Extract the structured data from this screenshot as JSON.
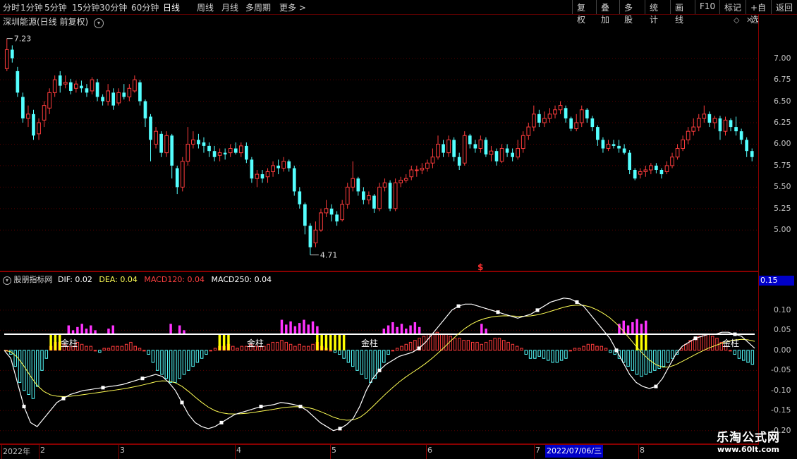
{
  "toolbar": {
    "left": [
      "分时",
      "1分钟",
      "5分钟",
      "15分钟",
      "30分钟",
      "60分钟",
      "日线",
      "周线",
      "月线",
      "多周期",
      "更多 >"
    ],
    "active": "日线",
    "right": [
      "复权",
      "叠加",
      "多股",
      "统计",
      "画线",
      "F10",
      "标记",
      "+自选",
      "返回"
    ]
  },
  "main": {
    "title": "深圳能源(日线 前复权)",
    "high_label": "7.23",
    "low_label": "4.71",
    "signal_label": "$",
    "y_labels": [
      "7.00",
      "6.75",
      "6.50",
      "6.25",
      "6.00",
      "5.75",
      "5.50",
      "5.25",
      "5.00"
    ]
  },
  "indicator": {
    "name": "股朋指标网",
    "dif": "DIF: 0.02",
    "dea": "DEA: 0.04",
    "macd120": "MACD120: 0.04",
    "macd250": "MACD250: 0.04",
    "current_value": "0.15",
    "y_labels": [
      "0.10",
      "0.05",
      "0.00",
      "-0.05",
      "-0.10",
      "-0.15",
      "-0.20"
    ],
    "golden_label": "金柱"
  },
  "date_axis": {
    "labels": [
      "2022年",
      "2",
      "3",
      "4",
      "5",
      "6",
      "7",
      "8"
    ],
    "cursor_date": "2022/07/06/三"
  },
  "watermark": {
    "title": "乐淘公式网",
    "url": "www.60lt.com"
  },
  "colors": {
    "up": "#ff3c3c",
    "down": "#54ffff",
    "grid": "#5a0000",
    "dif": "#ffffff",
    "dea": "#ffff55",
    "magenta": "#ff33ff",
    "yellow": "#ffff00"
  },
  "chart_data": {
    "type": "candlestick",
    "candles": [
      [
        6.88,
        7.1,
        7.23,
        6.85
      ],
      [
        7.1,
        7.0,
        7.15,
        6.95
      ],
      [
        6.85,
        6.6,
        6.9,
        6.55
      ],
      [
        6.55,
        6.3,
        6.6,
        6.25
      ],
      [
        6.3,
        6.35,
        6.45,
        6.2
      ],
      [
        6.35,
        6.1,
        6.4,
        6.05
      ],
      [
        6.12,
        6.25,
        6.3,
        6.05
      ],
      [
        6.28,
        6.45,
        6.5,
        6.2
      ],
      [
        6.42,
        6.6,
        6.65,
        6.35
      ],
      [
        6.6,
        6.75,
        6.8,
        6.55
      ],
      [
        6.8,
        6.68,
        6.85,
        6.6
      ],
      [
        6.7,
        6.72,
        6.8,
        6.65
      ],
      [
        6.72,
        6.62,
        6.76,
        6.58
      ],
      [
        6.65,
        6.7,
        6.74,
        6.6
      ],
      [
        6.68,
        6.65,
        6.74,
        6.6
      ],
      [
        6.65,
        6.6,
        6.7,
        6.55
      ],
      [
        6.62,
        6.75,
        6.78,
        6.58
      ],
      [
        6.72,
        6.55,
        6.76,
        6.5
      ],
      [
        6.55,
        6.5,
        6.58,
        6.45
      ],
      [
        6.5,
        6.62,
        6.7,
        6.45
      ],
      [
        6.6,
        6.45,
        6.65,
        6.4
      ],
      [
        6.48,
        6.6,
        6.65,
        6.45
      ],
      [
        6.6,
        6.55,
        6.7,
        6.52
      ],
      [
        6.55,
        6.65,
        6.7,
        6.5
      ],
      [
        6.62,
        6.75,
        6.8,
        6.6
      ],
      [
        6.72,
        6.5,
        6.75,
        6.45
      ],
      [
        6.5,
        6.3,
        6.52,
        6.2
      ],
      [
        6.32,
        6.05,
        6.35,
        5.8
      ],
      [
        6.0,
        6.15,
        6.2,
        5.95
      ],
      [
        6.12,
        5.9,
        6.15,
        5.85
      ],
      [
        5.9,
        6.1,
        6.15,
        5.85
      ],
      [
        6.1,
        5.75,
        6.12,
        5.6
      ],
      [
        5.72,
        5.5,
        5.75,
        5.42
      ],
      [
        5.5,
        5.8,
        5.85,
        5.45
      ],
      [
        5.8,
        6.0,
        6.2,
        5.75
      ],
      [
        6.0,
        6.05,
        6.15,
        5.95
      ],
      [
        6.05,
        6.0,
        6.12,
        5.95
      ],
      [
        6.02,
        5.98,
        6.08,
        5.9
      ],
      [
        5.98,
        5.92,
        6.02,
        5.85
      ],
      [
        5.92,
        5.85,
        5.98,
        5.8
      ],
      [
        5.87,
        5.9,
        5.95,
        5.8
      ],
      [
        5.9,
        5.88,
        5.95,
        5.82
      ],
      [
        5.9,
        5.95,
        6.0,
        5.85
      ],
      [
        5.95,
        5.9,
        6.02,
        5.88
      ],
      [
        5.9,
        5.98,
        6.02,
        5.85
      ],
      [
        5.98,
        5.82,
        6.02,
        5.78
      ],
      [
        5.82,
        5.6,
        5.85,
        5.55
      ],
      [
        5.6,
        5.65,
        5.7,
        5.5
      ],
      [
        5.65,
        5.6,
        5.7,
        5.55
      ],
      [
        5.62,
        5.68,
        5.72,
        5.55
      ],
      [
        5.68,
        5.75,
        5.8,
        5.62
      ],
      [
        5.75,
        5.72,
        5.82,
        5.65
      ],
      [
        5.72,
        5.8,
        5.85,
        5.68
      ],
      [
        5.8,
        5.72,
        5.82,
        5.68
      ],
      [
        5.72,
        5.45,
        5.75,
        5.4
      ],
      [
        5.45,
        5.3,
        5.5,
        5.25
      ],
      [
        5.3,
        5.05,
        5.32,
        4.95
      ],
      [
        5.05,
        4.8,
        5.08,
        4.71
      ],
      [
        4.85,
        5.0,
        5.1,
        4.8
      ],
      [
        5.0,
        5.2,
        5.25,
        4.98
      ],
      [
        5.2,
        5.25,
        5.35,
        5.15
      ],
      [
        5.25,
        5.18,
        5.3,
        5.1
      ],
      [
        5.18,
        5.1,
        5.22,
        5.05
      ],
      [
        5.12,
        5.3,
        5.35,
        5.1
      ],
      [
        5.3,
        5.5,
        5.55,
        5.25
      ],
      [
        5.5,
        5.6,
        5.8,
        5.45
      ],
      [
        5.6,
        5.45,
        5.62,
        5.4
      ],
      [
        5.45,
        5.35,
        5.5,
        5.3
      ],
      [
        5.35,
        5.4,
        5.45,
        5.3
      ],
      [
        5.4,
        5.25,
        5.42,
        5.2
      ],
      [
        5.25,
        5.5,
        5.55,
        5.22
      ],
      [
        5.5,
        5.55,
        5.6,
        5.45
      ],
      [
        5.55,
        5.25,
        5.58,
        5.22
      ],
      [
        5.25,
        5.55,
        5.6,
        5.22
      ],
      [
        5.55,
        5.58,
        5.62,
        5.5
      ],
      [
        5.58,
        5.6,
        5.65,
        5.55
      ],
      [
        5.62,
        5.7,
        5.75,
        5.58
      ],
      [
        5.7,
        5.7,
        5.75,
        5.62
      ],
      [
        5.7,
        5.72,
        5.78,
        5.65
      ],
      [
        5.72,
        5.78,
        5.82,
        5.68
      ],
      [
        5.78,
        5.85,
        5.95,
        5.72
      ],
      [
        5.85,
        6.0,
        6.1,
        5.82
      ],
      [
        6.0,
        5.9,
        6.05,
        5.85
      ],
      [
        5.9,
        6.05,
        6.1,
        5.85
      ],
      [
        6.05,
        5.85,
        6.08,
        5.8
      ],
      [
        5.85,
        5.75,
        5.9,
        5.7
      ],
      [
        5.78,
        6.1,
        6.15,
        5.75
      ],
      [
        6.1,
        6.0,
        6.12,
        5.95
      ],
      [
        6.0,
        5.95,
        6.05,
        5.9
      ],
      [
        5.95,
        6.05,
        6.1,
        5.9
      ],
      [
        6.05,
        5.88,
        6.08,
        5.85
      ],
      [
        5.88,
        5.92,
        5.98,
        5.8
      ],
      [
        5.92,
        5.8,
        5.95,
        5.75
      ],
      [
        5.8,
        5.95,
        6.0,
        5.78
      ],
      [
        5.95,
        5.9,
        6.0,
        5.85
      ],
      [
        5.9,
        5.85,
        5.95,
        5.8
      ],
      [
        5.85,
        5.95,
        6.05,
        5.82
      ],
      [
        5.95,
        6.1,
        6.15,
        5.9
      ],
      [
        6.1,
        6.2,
        6.25,
        6.05
      ],
      [
        6.2,
        6.35,
        6.45,
        6.15
      ],
      [
        6.35,
        6.25,
        6.4,
        6.2
      ],
      [
        6.25,
        6.3,
        6.38,
        6.2
      ],
      [
        6.3,
        6.35,
        6.42,
        6.25
      ],
      [
        6.35,
        6.4,
        6.45,
        6.3
      ],
      [
        6.4,
        6.45,
        6.5,
        6.35
      ],
      [
        6.42,
        6.3,
        6.45,
        6.25
      ],
      [
        6.3,
        6.18,
        6.32,
        6.15
      ],
      [
        6.18,
        6.25,
        6.35,
        6.15
      ],
      [
        6.25,
        6.4,
        6.45,
        6.2
      ],
      [
        6.4,
        6.3,
        6.42,
        6.25
      ],
      [
        6.3,
        6.2,
        6.33,
        6.15
      ],
      [
        6.2,
        6.05,
        6.22,
        5.98
      ],
      [
        6.05,
        5.95,
        6.08,
        5.9
      ],
      [
        5.95,
        6.0,
        6.05,
        5.92
      ],
      [
        6.0,
        5.98,
        6.05,
        5.95
      ],
      [
        5.98,
        5.95,
        6.05,
        5.9
      ],
      [
        5.95,
        5.9,
        6.0,
        5.88
      ],
      [
        5.9,
        5.7,
        5.93,
        5.65
      ],
      [
        5.7,
        5.6,
        5.72,
        5.58
      ],
      [
        5.65,
        5.68,
        5.72,
        5.6
      ],
      [
        5.68,
        5.7,
        5.75,
        5.62
      ],
      [
        5.7,
        5.75,
        5.78,
        5.65
      ],
      [
        5.75,
        5.7,
        5.78,
        5.66
      ],
      [
        5.7,
        5.65,
        5.72,
        5.6
      ],
      [
        5.68,
        5.75,
        5.8,
        5.65
      ],
      [
        5.75,
        5.85,
        5.9,
        5.72
      ],
      [
        5.85,
        5.95,
        6.0,
        5.82
      ],
      [
        5.95,
        6.05,
        6.1,
        5.92
      ],
      [
        6.05,
        6.15,
        6.2,
        6.0
      ],
      [
        6.15,
        6.2,
        6.3,
        6.1
      ],
      [
        6.2,
        6.3,
        6.35,
        6.15
      ],
      [
        6.3,
        6.35,
        6.45,
        6.25
      ],
      [
        6.35,
        6.25,
        6.38,
        6.2
      ],
      [
        6.25,
        6.3,
        6.33,
        6.18
      ],
      [
        6.3,
        6.15,
        6.33,
        6.05
      ],
      [
        6.15,
        6.28,
        6.32,
        6.1
      ],
      [
        6.28,
        6.2,
        6.3,
        6.15
      ],
      [
        6.2,
        6.15,
        6.32,
        6.1
      ],
      [
        6.15,
        6.05,
        6.18,
        6.0
      ],
      [
        6.05,
        5.92,
        6.08,
        5.85
      ],
      [
        5.92,
        5.85,
        5.95,
        5.8
      ]
    ],
    "y_range": [
      4.6,
      7.35
    ],
    "macd_hist": [
      0.0,
      -0.01,
      -0.04,
      -0.08,
      -0.1,
      -0.11,
      -0.12,
      -0.09,
      -0.05,
      -0.02,
      0.01,
      0.02,
      0.02,
      0.015,
      0.01,
      0.01,
      0.02,
      0.015,
      0.01,
      0.01,
      0.0,
      -0.005,
      0.005,
      0.005,
      0.01,
      0.01,
      0.01,
      0.015,
      0.02,
      0.01,
      0.005,
      0.0,
      -0.01,
      -0.03,
      -0.05,
      -0.06,
      -0.07,
      -0.08,
      -0.08,
      -0.07,
      -0.06,
      -0.05,
      -0.04,
      -0.03,
      -0.02,
      -0.01,
      0.0,
      0.005,
      0.01,
      0.01,
      0.015,
      0.01,
      0.005,
      0.01,
      0.01,
      0.015,
      0.01,
      0.01,
      0.01,
      0.015,
      0.02,
      0.02,
      0.025,
      0.02,
      0.015,
      0.01,
      0.015,
      0.01,
      0.01,
      0.015,
      0.02,
      0.01,
      0.005,
      0.0,
      -0.005,
      -0.01,
      -0.02,
      -0.03,
      -0.04,
      -0.05,
      -0.06,
      -0.07,
      -0.08,
      -0.07,
      -0.05,
      -0.03,
      -0.01,
      0.0,
      0.005,
      0.01,
      0.015,
      0.02,
      0.025,
      0.03,
      0.035,
      0.04,
      0.04,
      0.045,
      0.04,
      0.04,
      0.035,
      0.03,
      0.03,
      0.025,
      0.025,
      0.02,
      0.02,
      0.015,
      0.02,
      0.025,
      0.03,
      0.03,
      0.025,
      0.02,
      0.015,
      0.01,
      0.005,
      -0.01,
      -0.02,
      -0.02,
      -0.015,
      -0.02,
      -0.025,
      -0.03,
      -0.03,
      -0.025,
      -0.02,
      0.0,
      0.005,
      0.005,
      0.01,
      0.015,
      0.015,
      0.01,
      0.01,
      0.005,
      -0.005,
      -0.01,
      -0.02,
      -0.03,
      -0.04,
      -0.05,
      -0.06,
      -0.065,
      -0.06,
      -0.055,
      -0.05,
      -0.045,
      -0.04,
      -0.03,
      -0.02,
      -0.01,
      0.005,
      0.015,
      0.025,
      0.03,
      0.035,
      0.04,
      0.04,
      0.035,
      0.03,
      0.02,
      0.01,
      0.0,
      -0.01,
      -0.02,
      -0.025,
      -0.03,
      -0.035
    ],
    "dif": [
      0.0,
      -0.02,
      -0.08,
      -0.14,
      -0.18,
      -0.19,
      -0.17,
      -0.15,
      -0.13,
      -0.12,
      -0.11,
      -0.105,
      -0.1,
      -0.098,
      -0.095,
      -0.093,
      -0.09,
      -0.088,
      -0.085,
      -0.08,
      -0.075,
      -0.07,
      -0.065,
      -0.06,
      -0.065,
      -0.08,
      -0.1,
      -0.13,
      -0.16,
      -0.18,
      -0.19,
      -0.195,
      -0.19,
      -0.18,
      -0.17,
      -0.16,
      -0.155,
      -0.15,
      -0.145,
      -0.14,
      -0.138,
      -0.135,
      -0.13,
      -0.132,
      -0.135,
      -0.14,
      -0.15,
      -0.165,
      -0.18,
      -0.19,
      -0.2,
      -0.195,
      -0.185,
      -0.17,
      -0.14,
      -0.1,
      -0.07,
      -0.05,
      -0.035,
      -0.025,
      -0.015,
      -0.01,
      -0.005,
      0.005,
      0.02,
      0.04,
      0.06,
      0.08,
      0.1,
      0.11,
      0.115,
      0.115,
      0.11,
      0.105,
      0.1,
      0.095,
      0.09,
      0.085,
      0.08,
      0.085,
      0.09,
      0.1,
      0.11,
      0.12,
      0.125,
      0.13,
      0.128,
      0.12,
      0.11,
      0.09,
      0.07,
      0.05,
      0.03,
      0.0,
      -0.03,
      -0.06,
      -0.08,
      -0.09,
      -0.095,
      -0.09,
      -0.07,
      -0.04,
      -0.01,
      0.01,
      0.02,
      0.03,
      0.035,
      0.04,
      0.04,
      0.045,
      0.045,
      0.04,
      0.035,
      0.02,
      0.005
    ]
  }
}
